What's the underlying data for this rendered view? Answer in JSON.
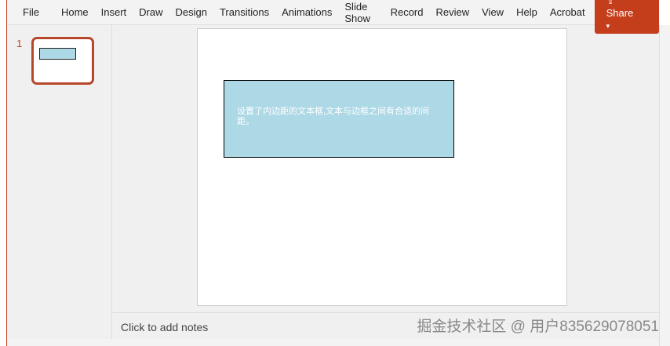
{
  "ribbon": {
    "tabs": [
      "File",
      "Home",
      "Insert",
      "Draw",
      "Design",
      "Transitions",
      "Animations",
      "Slide Show",
      "Record",
      "Review",
      "View",
      "Help",
      "Acrobat"
    ],
    "share": "Share"
  },
  "thumbnails": {
    "slide_number": "1"
  },
  "slide": {
    "textbox": "设置了内边距的文本框,文本与边框之间有合适的间距。"
  },
  "notes": {
    "placeholder": "Click to add notes"
  },
  "watermark": "掘金技术社区 @ 用户835629078051",
  "colors": {
    "accent": "#c43e1c",
    "textbox_fill": "#add8e6"
  }
}
